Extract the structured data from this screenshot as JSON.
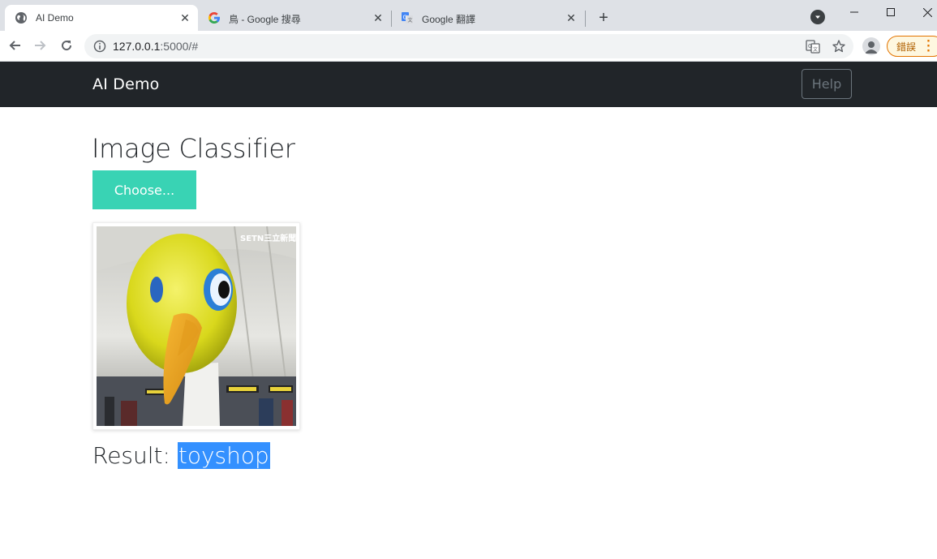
{
  "browser": {
    "tabs": [
      {
        "title": "AI Demo",
        "active": true,
        "icon": "globe-icon"
      },
      {
        "title": "鳥 - Google 搜尋",
        "active": false,
        "icon": "google-g-icon"
      },
      {
        "title": "Google 翻譯",
        "active": false,
        "icon": "google-translate-icon"
      }
    ],
    "url_host": "127.0.0.1",
    "url_rest": ":5000/#",
    "error_badge": "錯誤"
  },
  "navbar": {
    "brand": "AI Demo",
    "help_label": "Help"
  },
  "main": {
    "heading": "Image Classifier",
    "choose_label": "Choose...",
    "watermark": "SETN三立新聞網",
    "result_label": "Result:",
    "result_value": "toyshop"
  },
  "colors": {
    "navbar_bg": "#212529",
    "choose_button": "#39d3b4",
    "selection": "#3390ff",
    "error_badge_border": "#e37400"
  }
}
